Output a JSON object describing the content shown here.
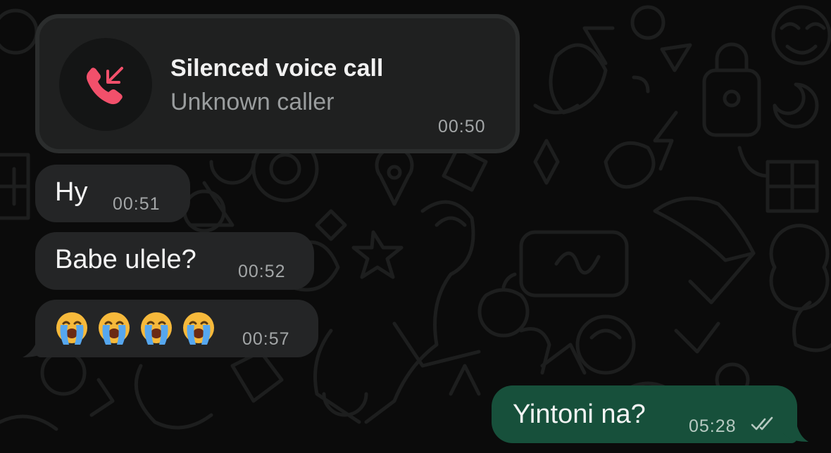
{
  "call": {
    "title": "Silenced voice call",
    "subtitle": "Unknown caller",
    "time": "00:50",
    "icon": "missed-call-icon",
    "accent": "#f2506b"
  },
  "messages": [
    {
      "text": "Hy",
      "time": "00:51",
      "direction": "incoming"
    },
    {
      "text": "Babe ulele?",
      "time": "00:52",
      "direction": "incoming"
    },
    {
      "emoji": [
        "loudly-crying-face",
        "loudly-crying-face",
        "loudly-crying-face",
        "loudly-crying-face"
      ],
      "time": "00:57",
      "direction": "incoming"
    },
    {
      "text": "Yintoni na?",
      "time": "05:28",
      "direction": "outgoing",
      "status": "read-double-check-icon"
    }
  ],
  "colors": {
    "background": "#0b0b0b",
    "incoming_bubble": "#242526",
    "outgoing_bubble": "#17503b",
    "timestamp": "#a3a6a7"
  }
}
